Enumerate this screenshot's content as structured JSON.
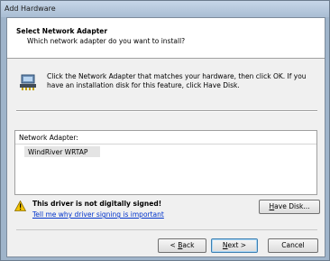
{
  "window": {
    "title": "Add Hardware"
  },
  "header": {
    "title": "Select Network Adapter",
    "subtitle": "Which network adapter do you want to install?"
  },
  "instructions": {
    "text": "Click the Network Adapter that matches your hardware, then click OK. If you have an installation disk for this feature, click Have Disk.",
    "icon": "network-adapter-icon"
  },
  "list": {
    "header": "Network Adapter:",
    "items": [
      "WindRiver WRTAP"
    ]
  },
  "warning": {
    "icon": "warning-icon",
    "text": "This driver is not digitally signed!",
    "link": "Tell me why driver signing is important"
  },
  "buttons": {
    "have_disk": {
      "prefix": "",
      "hotkey": "H",
      "suffix": "ave Disk..."
    },
    "back": {
      "prefix": "< ",
      "hotkey": "B",
      "suffix": "ack"
    },
    "next": {
      "prefix": "",
      "hotkey": "N",
      "suffix": "ext >"
    },
    "cancel": "Cancel"
  },
  "colors": {
    "titlebar": "#a9bdd3",
    "link": "#0033cc",
    "selection": "#e4e4e4"
  }
}
